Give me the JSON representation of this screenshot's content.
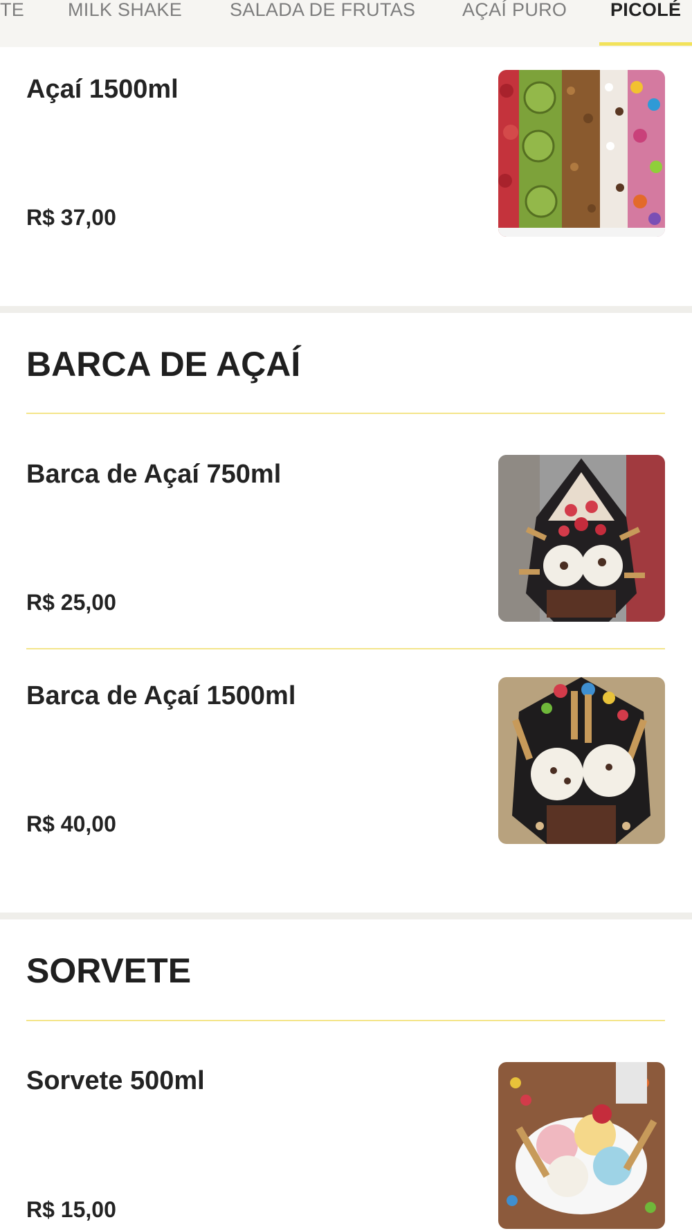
{
  "tabs": [
    {
      "label": "TE"
    },
    {
      "label": "MILK SHAKE"
    },
    {
      "label": "SALADA DE FRUTAS"
    },
    {
      "label": "AÇAÍ PURO"
    },
    {
      "label": "PICOLÉ",
      "active": true
    }
  ],
  "items_top": [
    {
      "name": "Açaí 1500ml",
      "price": "R$ 37,00"
    }
  ],
  "sections": [
    {
      "title": "BARCA DE AÇAÍ",
      "items": [
        {
          "name": "Barca de Açaí 750ml",
          "price": "R$ 25,00"
        },
        {
          "name": "Barca de Açaí 1500ml",
          "price": "R$ 40,00"
        }
      ]
    },
    {
      "title": "SORVETE",
      "items": [
        {
          "name": "Sorvete 500ml",
          "price": "R$ 15,00"
        }
      ]
    }
  ],
  "colors": {
    "accent_yellow": "#f2e25b",
    "divider": "#f4e58a",
    "tabbar_bg": "#f6f5f2",
    "section_gap": "#efeeea"
  }
}
